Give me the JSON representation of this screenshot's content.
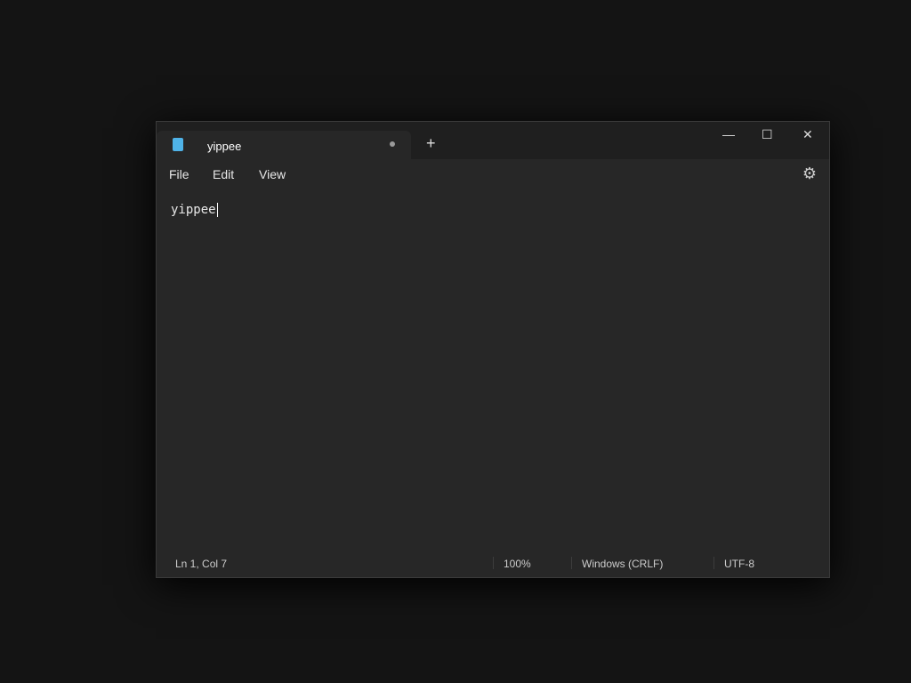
{
  "tab": {
    "title": "yippee",
    "plus": "+"
  },
  "controls": {
    "min": "—",
    "max": "☐",
    "close": "✕"
  },
  "menu": {
    "file": "File",
    "edit": "Edit",
    "view": "View",
    "gear": "⚙"
  },
  "editor": {
    "text": "yippee"
  },
  "status": {
    "pos": "Ln 1, Col 7",
    "zoom": "100%",
    "eol": "Windows (CRLF)",
    "enc": "UTF-8"
  }
}
